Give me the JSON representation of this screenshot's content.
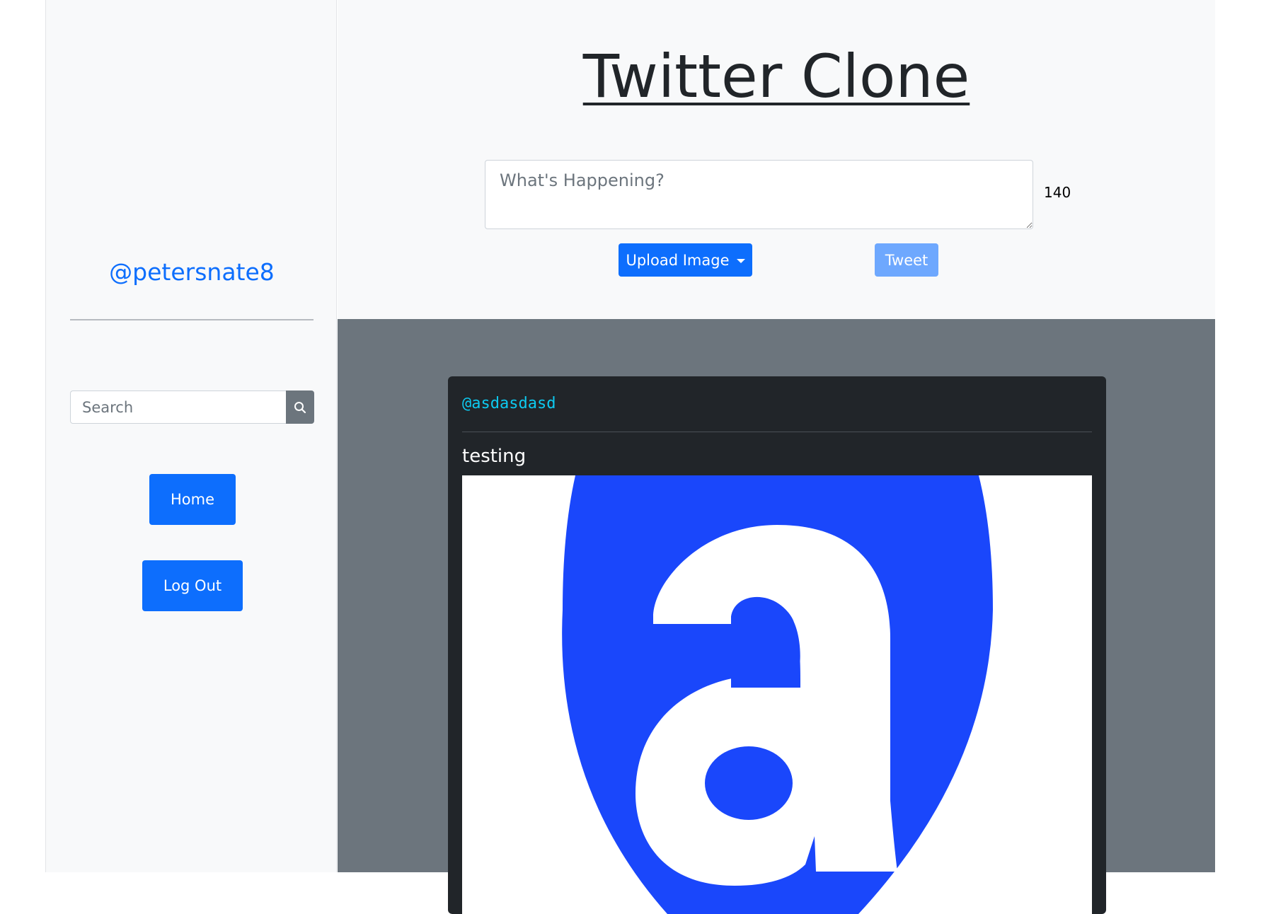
{
  "sidebar": {
    "username": "@petersnate8",
    "search_placeholder": "Search",
    "search_icon": "search-icon",
    "home_label": "Home",
    "logout_label": "Log Out"
  },
  "header": {
    "title": "Twitter Clone",
    "tweet_placeholder": "What's Happening?",
    "char_count": "140",
    "upload_label": "Upload Image",
    "tweet_label": "Tweet"
  },
  "feed": {
    "tweets": [
      {
        "user": "@asdasdasd",
        "text": "testing",
        "image_icon": "letter-a-logo-image"
      }
    ]
  },
  "colors": {
    "primary": "#0d6efd",
    "tweet_disabled": "#6ea8fe",
    "feed_bg": "#6c757d",
    "card_bg": "#212529",
    "user_link": "#0dcaf0",
    "logo_blue": "#1a47fb"
  }
}
